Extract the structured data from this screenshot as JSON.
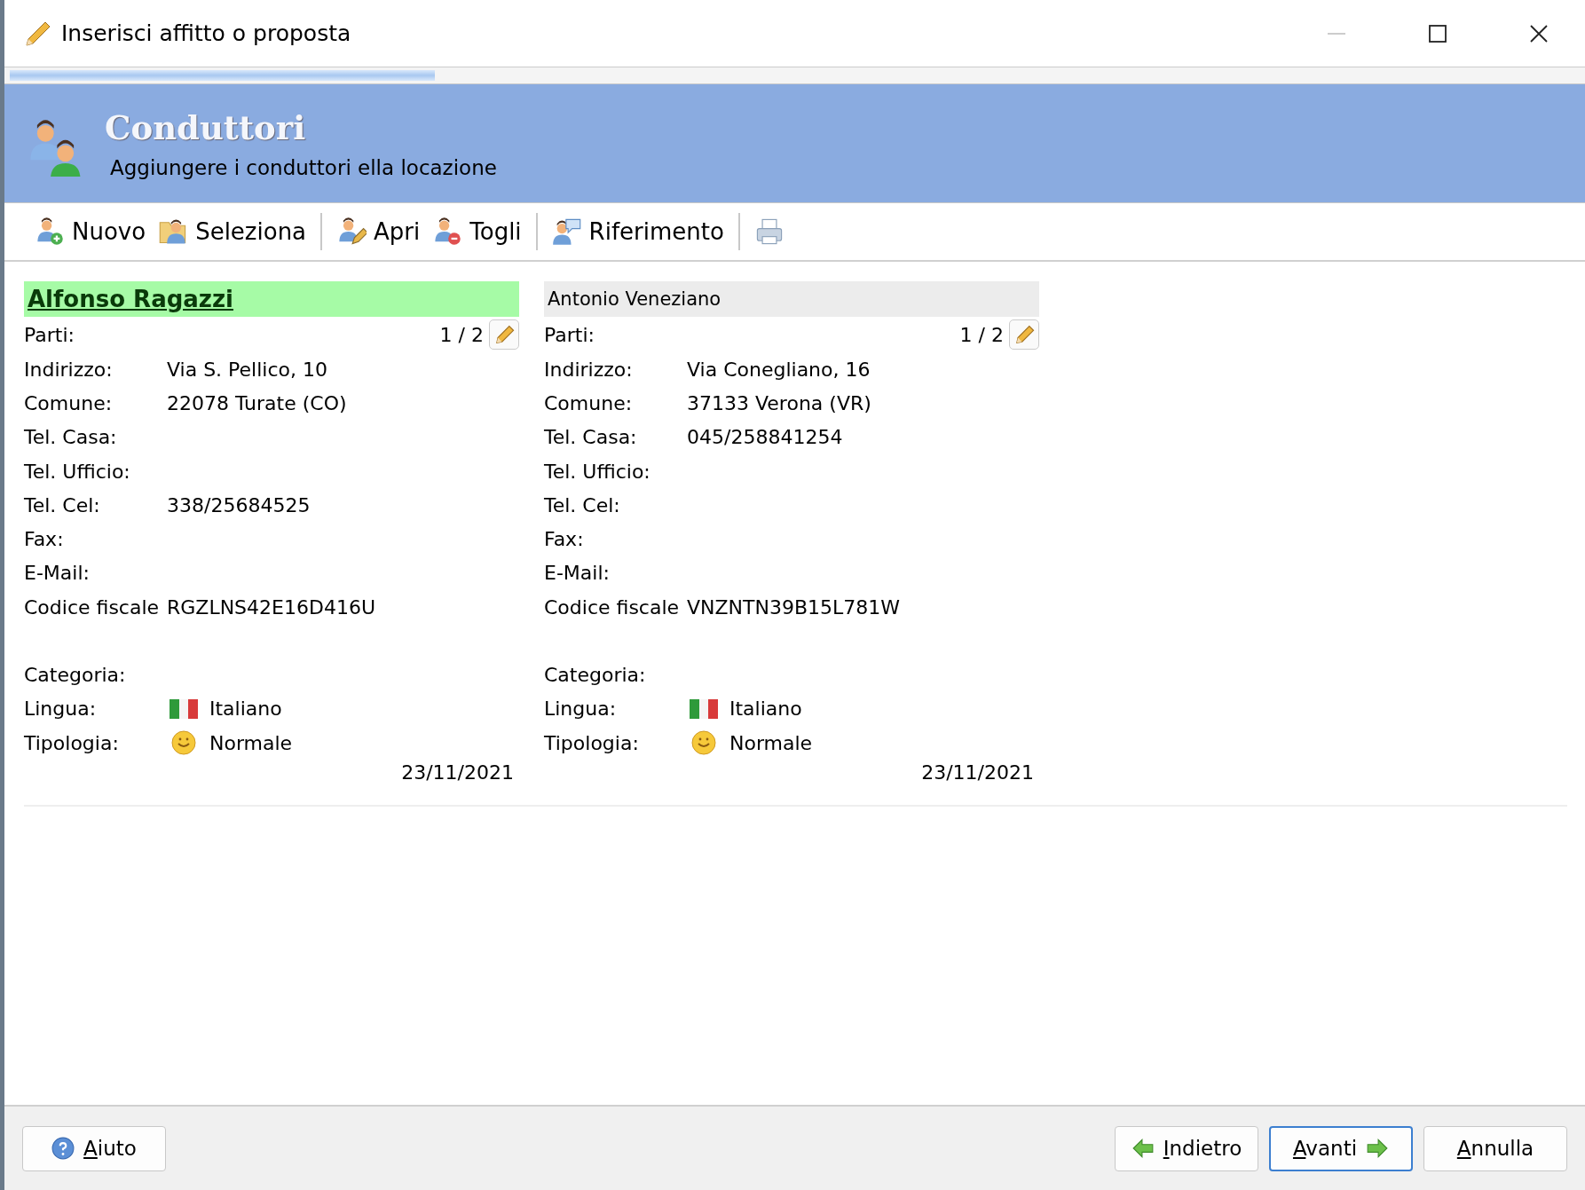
{
  "window": {
    "title": "Inserisci affitto o proposta"
  },
  "progress": {
    "level": 0.27
  },
  "header": {
    "title": "Conduttori",
    "subtitle": "Aggiungere i conduttori ella locazione"
  },
  "toolbar": [
    {
      "kind": "add",
      "label": "Nuovo"
    },
    {
      "kind": "select",
      "label": "Seleziona"
    },
    {
      "kind": "separator"
    },
    {
      "kind": "open",
      "label": "Apri"
    },
    {
      "kind": "remove",
      "label": "Togli"
    },
    {
      "kind": "separator"
    },
    {
      "kind": "reference",
      "label": "Riferimento"
    },
    {
      "kind": "separator"
    },
    {
      "kind": "print"
    }
  ],
  "tenants": [
    {
      "name": "Alfonso  Ragazzi",
      "selected": true,
      "parts_label": "Parti:",
      "parts": "1 / 2",
      "fields": [
        {
          "label": "Indirizzo:",
          "value": "Via S. Pellico, 10"
        },
        {
          "label": "Comune:",
          "value": "22078 Turate  (CO)"
        },
        {
          "label": "Tel. Casa:"
        },
        {
          "label": "Tel. Ufficio:"
        },
        {
          "label": "Tel. Cel:",
          "value": "338/25684525"
        },
        {
          "label": "Fax:"
        },
        {
          "label": "E-Mail:"
        },
        {
          "label": "Codice fiscale",
          "value": "RGZLNS42E16D416U"
        }
      ],
      "extra": [
        {
          "kind": "text",
          "label": "Categoria:"
        },
        {
          "kind": "flag",
          "label": "Lingua:",
          "value": "Italiano"
        },
        {
          "kind": "smiley",
          "label": "Tipologia:",
          "value": "Normale"
        }
      ],
      "date": "23/11/2021"
    },
    {
      "name": "Antonio Veneziano",
      "selected": false,
      "parts_label": "Parti:",
      "parts": "1 / 2",
      "fields": [
        {
          "label": "Indirizzo:",
          "value": "Via Conegliano, 16"
        },
        {
          "label": "Comune:",
          "value": "37133 Verona (VR)"
        },
        {
          "label": "Tel. Casa:",
          "value": "045/258841254"
        },
        {
          "label": "Tel. Ufficio:"
        },
        {
          "label": "Tel. Cel:"
        },
        {
          "label": "Fax:"
        },
        {
          "label": "E-Mail:"
        },
        {
          "label": "Codice fiscale",
          "value": "VNZNTN39B15L781W"
        }
      ],
      "extra": [
        {
          "kind": "text",
          "label": "Categoria:"
        },
        {
          "kind": "flag",
          "label": "Lingua:",
          "value": "Italiano"
        },
        {
          "kind": "smiley",
          "label": "Tipologia:",
          "value": "Normale"
        }
      ],
      "date": "23/11/2021"
    }
  ],
  "footer": {
    "buttons": [
      {
        "kind": "help",
        "label": "Aiuto",
        "default": false
      },
      {
        "kind": "back",
        "label": "Indietro",
        "default": false
      },
      {
        "kind": "next",
        "label": "Avanti",
        "default": true
      },
      {
        "kind": "cancel",
        "label": "Annulla",
        "default": false
      }
    ]
  }
}
